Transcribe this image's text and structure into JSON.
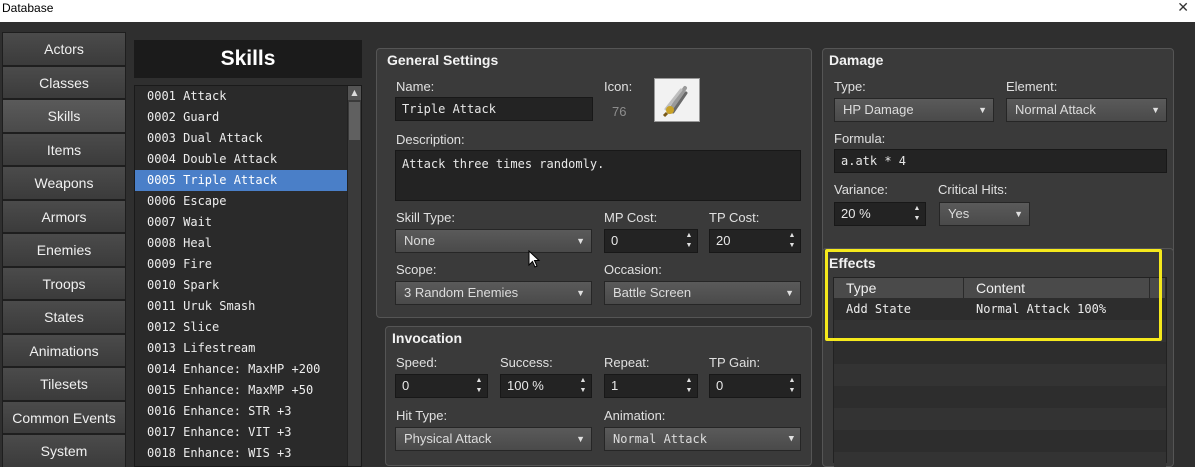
{
  "window": {
    "title": "Database",
    "close_glyph": "✕"
  },
  "tabs": [
    "Actors",
    "Classes",
    "Skills",
    "Items",
    "Weapons",
    "Armors",
    "Enemies",
    "Troops",
    "States",
    "Animations",
    "Tilesets",
    "Common Events",
    "System"
  ],
  "active_tab": "Skills",
  "skills_header": "Skills",
  "skill_list": [
    "0001 Attack",
    "0002 Guard",
    "0003 Dual Attack",
    "0004 Double Attack",
    "0005 Triple Attack",
    "0006 Escape",
    "0007 Wait",
    "0008 Heal",
    "0009 Fire",
    "0010 Spark",
    "0011 Uruk Smash",
    "0012 Slice",
    "0013 Lifestream",
    "0014 Enhance: MaxHP +200",
    "0015 Enhance: MaxMP +50",
    "0016 Enhance: STR +3",
    "0017 Enhance: VIT +3",
    "0018 Enhance: WIS +3"
  ],
  "selected_skill_index": 4,
  "general": {
    "title": "General Settings",
    "name_label": "Name:",
    "name_value": "Triple Attack",
    "icon_label": "Icon:",
    "icon_index": "76",
    "desc_label": "Description:",
    "desc_value": "Attack three times randomly.",
    "skill_type_label": "Skill Type:",
    "skill_type_value": "None",
    "mp_cost_label": "MP Cost:",
    "mp_cost_value": "0",
    "tp_cost_label": "TP Cost:",
    "tp_cost_value": "20",
    "scope_label": "Scope:",
    "scope_value": "3 Random Enemies",
    "occasion_label": "Occasion:",
    "occasion_value": "Battle Screen"
  },
  "invocation": {
    "title": "Invocation",
    "speed_label": "Speed:",
    "speed_value": "0",
    "success_label": "Success:",
    "success_value": "100 %",
    "repeat_label": "Repeat:",
    "repeat_value": "1",
    "tp_gain_label": "TP Gain:",
    "tp_gain_value": "0",
    "hit_type_label": "Hit Type:",
    "hit_type_value": "Physical Attack",
    "animation_label": "Animation:",
    "animation_value": "Normal Attack"
  },
  "damage": {
    "title": "Damage",
    "type_label": "Type:",
    "type_value": "HP Damage",
    "element_label": "Element:",
    "element_value": "Normal Attack",
    "formula_label": "Formula:",
    "formula_value": "a.atk * 4",
    "variance_label": "Variance:",
    "variance_value": "20 %",
    "critical_label": "Critical Hits:",
    "critical_value": "Yes"
  },
  "effects": {
    "title": "Effects",
    "columns": [
      "Type",
      "Content"
    ],
    "rows": [
      {
        "type": "Add State",
        "content": "Normal Attack 100%"
      }
    ]
  },
  "colors": {
    "selection": "#4a7fc8",
    "highlight": "#f5e91c"
  }
}
